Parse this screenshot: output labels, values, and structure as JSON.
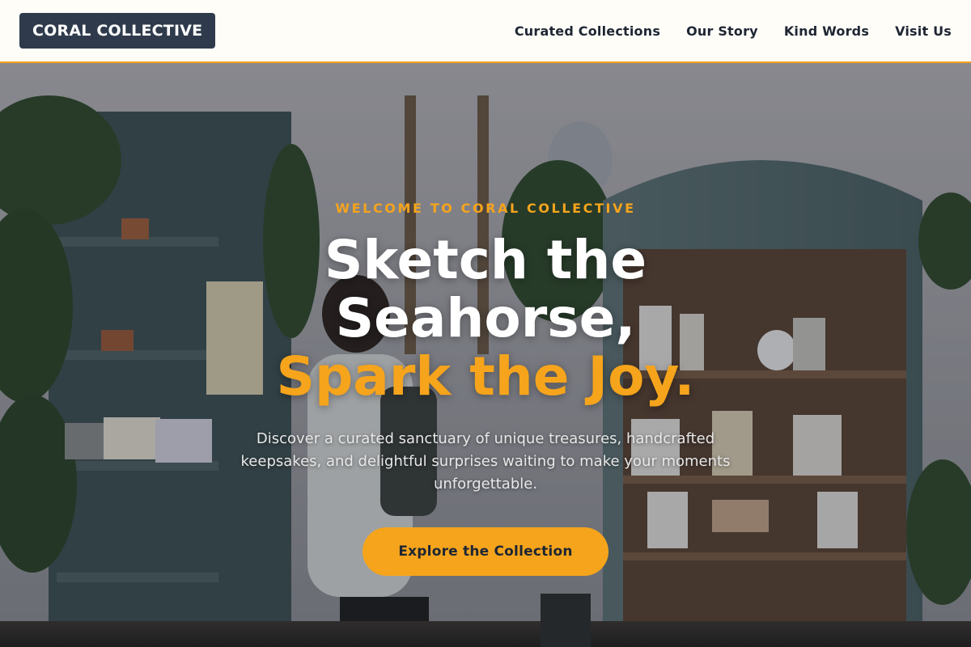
{
  "brand": {
    "name": "CORAL COLLECTIVE"
  },
  "nav": {
    "items": [
      "Curated Collections",
      "Our Story",
      "Kind Words",
      "Visit Us"
    ]
  },
  "hero": {
    "eyebrow": "WELCOME TO CORAL COLLECTIVE",
    "headline_line1": "Sketch the",
    "headline_line2": "Seahorse,",
    "headline_accent": "Spark the Joy.",
    "subtext": "Discover a curated sanctuary of unique treasures, handcrafted keepsakes, and delightful surprises waiting to make your moments unforgettable.",
    "cta_label": "Explore the Collection",
    "background_image": "shop-interior-shelves-photo"
  },
  "colors": {
    "accent": "#f5a41c",
    "logo_bg": "#2f3b4c",
    "header_bg": "#fffdf8",
    "nav_text": "#1e2633"
  }
}
